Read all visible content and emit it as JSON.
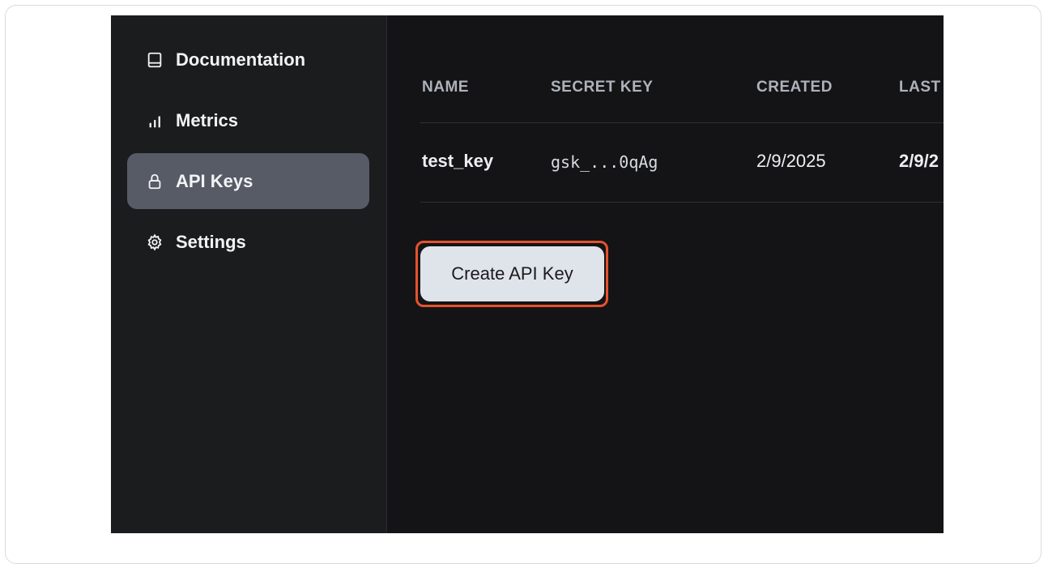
{
  "sidebar": {
    "items": [
      {
        "label": "Documentation",
        "icon": "book-icon",
        "active": false
      },
      {
        "label": "Metrics",
        "icon": "bar-chart-icon",
        "active": false
      },
      {
        "label": "API Keys",
        "icon": "lock-icon",
        "active": true
      },
      {
        "label": "Settings",
        "icon": "gear-icon",
        "active": false
      }
    ]
  },
  "table": {
    "headers": [
      "NAME",
      "SECRET KEY",
      "CREATED",
      "LAST"
    ],
    "rows": [
      {
        "name": "test_key",
        "secret": "gsk_...0qAg",
        "created": "2/9/2025",
        "last": "2/9/2"
      }
    ]
  },
  "actions": {
    "create_label": "Create API Key"
  },
  "colors": {
    "highlight": "#e5532e",
    "active_nav": "#565b66",
    "button_bg": "#dfe3ea"
  }
}
